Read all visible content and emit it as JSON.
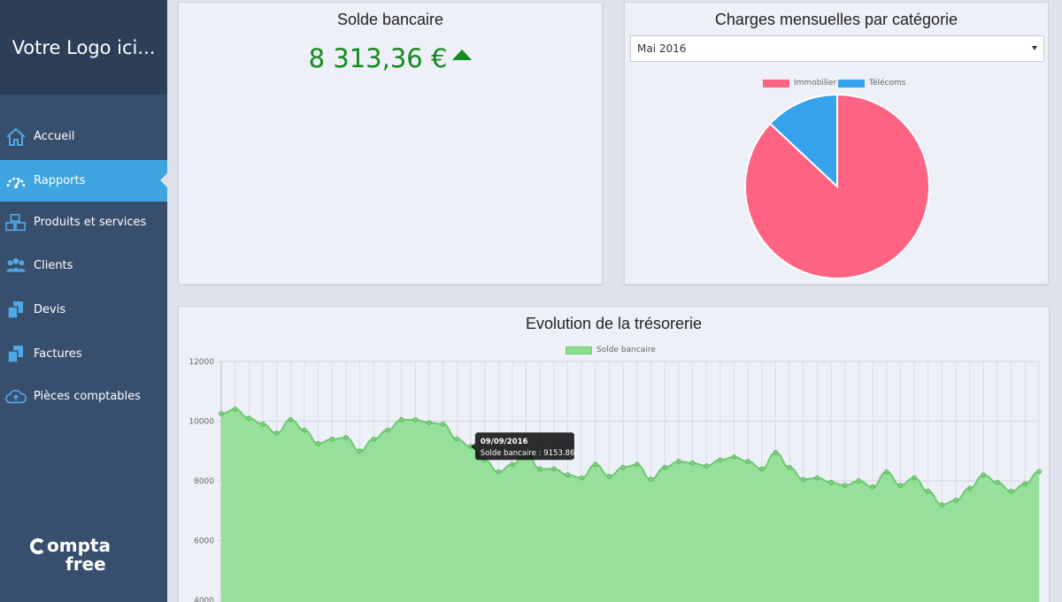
{
  "sidebar": {
    "logo": "Votre Logo ici...",
    "items": [
      {
        "label": "Accueil",
        "icon": "home-icon",
        "active": false
      },
      {
        "label": "Rapports",
        "icon": "dashboard-icon",
        "active": true
      },
      {
        "label": "Produits et services",
        "icon": "boxes-icon",
        "active": false
      },
      {
        "label": "Clients",
        "icon": "users-icon",
        "active": false
      },
      {
        "label": "Devis",
        "icon": "documents-icon",
        "active": false
      },
      {
        "label": "Factures",
        "icon": "documents-icon",
        "active": false
      },
      {
        "label": "Pièces comptables",
        "icon": "cloud-upload-icon",
        "active": false
      }
    ],
    "brand_line1": "ompta",
    "brand_line2": "free"
  },
  "balance_panel": {
    "title": "Solde bancaire",
    "value": "8 313,36 €",
    "trend": "up"
  },
  "charges_panel": {
    "title": "Charges mensuelles par catégorie",
    "month_selected": "Mai 2016"
  },
  "treasury_panel": {
    "title": "Evolution de la trésorerie"
  },
  "tooltip": {
    "date": "09/09/2016",
    "text": "Solde bancaire : 9153.86"
  },
  "colors": {
    "immobilier": "#ff6384",
    "telecoms": "#36a2eb",
    "area_fill": "#8ede91",
    "area_line": "#6cc96f",
    "active_nav": "#3ea5e0",
    "balance_green": "#128a1e"
  },
  "chart_data": [
    {
      "type": "pie",
      "categories": [
        "Immobilier",
        "Télécoms"
      ],
      "values": [
        87,
        13
      ],
      "legend_position": "top"
    },
    {
      "type": "area",
      "title": "Evolution de la trésorerie",
      "series": [
        {
          "name": "Solde bancaire",
          "values": [
            10250,
            10400,
            10100,
            9900,
            9600,
            10050,
            9700,
            9250,
            9400,
            9450,
            9000,
            9400,
            9700,
            10050,
            10050,
            9950,
            9900,
            9400,
            9150,
            8700,
            8300,
            8550,
            8950,
            8400,
            8400,
            8200,
            8100,
            8550,
            8150,
            8450,
            8550,
            8050,
            8450,
            8650,
            8600,
            8500,
            8700,
            8800,
            8650,
            8400,
            8950,
            8450,
            8050,
            8100,
            7950,
            7850,
            8000,
            7800,
            8300,
            7850,
            8100,
            7650,
            7200,
            7350,
            7750,
            8200,
            7950,
            7650,
            7900,
            8313
          ]
        }
      ],
      "ylim": [
        4000,
        12000
      ],
      "yticks": [
        4000,
        6000,
        8000,
        10000,
        12000
      ],
      "grid": true,
      "legend_position": "top"
    }
  ]
}
